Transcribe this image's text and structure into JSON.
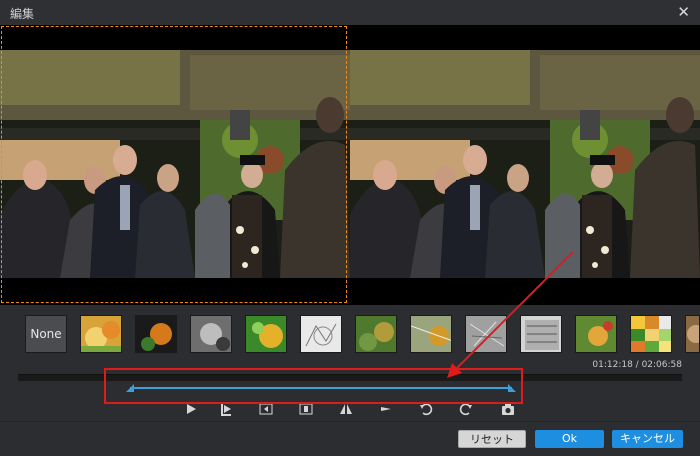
{
  "window": {
    "title": "編集",
    "close_icon": "close-icon"
  },
  "preview": {
    "left": {
      "name": "original-preview",
      "selected": true
    },
    "right": {
      "name": "filtered-preview"
    }
  },
  "filters": {
    "items": [
      {
        "label": "None",
        "icon": ""
      },
      {
        "label": "",
        "icon": "warm-flower-thumb"
      },
      {
        "label": "",
        "icon": "dark-flower-thumb"
      },
      {
        "label": "",
        "icon": "gray-flower-thumb"
      },
      {
        "label": "",
        "icon": "green-flower-thumb"
      },
      {
        "label": "",
        "icon": "sketch-flower-thumb"
      },
      {
        "label": "",
        "icon": "blur-flower-thumb"
      },
      {
        "label": "",
        "icon": "emboss-color-thumb"
      },
      {
        "label": "",
        "icon": "emboss-gray-thumb"
      },
      {
        "label": "",
        "icon": "noise-thumb"
      },
      {
        "label": "",
        "icon": "pencil-color-thumb"
      },
      {
        "label": "",
        "icon": "mosaic-thumb"
      },
      {
        "label": "",
        "icon": "sepia-thumb"
      }
    ]
  },
  "timeline": {
    "time": "01:12:18 / 02:06:58",
    "position": 0.57,
    "trim_start": 0.17,
    "trim_end": 0.75
  },
  "controls": [
    {
      "name": "play-icon"
    },
    {
      "name": "set-start-icon"
    },
    {
      "name": "prev-frame-icon"
    },
    {
      "name": "next-frame-icon"
    },
    {
      "name": "flip-horizontal-icon"
    },
    {
      "name": "flip-vertical-icon"
    },
    {
      "name": "rotate-left-icon"
    },
    {
      "name": "rotate-right-icon"
    },
    {
      "name": "snapshot-icon"
    }
  ],
  "buttons": {
    "reset": "リセット",
    "ok": "Ok",
    "cancel": "キャンセル"
  },
  "colors": {
    "accent": "#1e8fe0",
    "selection": "#f28a1c",
    "annotation": "#e01b1b",
    "trim": "#3aa0d8"
  }
}
